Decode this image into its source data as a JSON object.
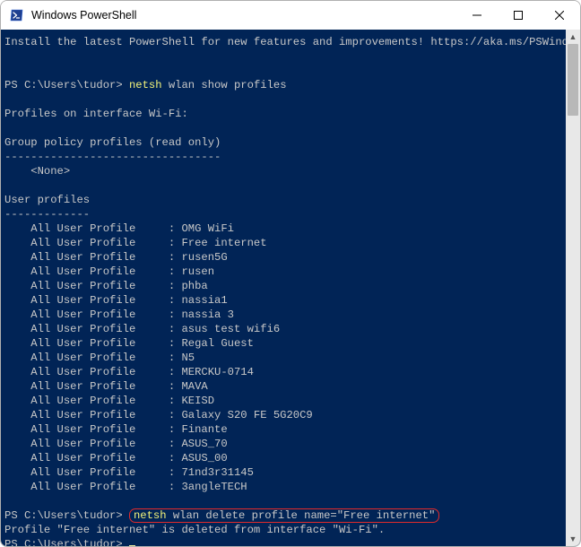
{
  "titlebar": {
    "title": "Windows PowerShell"
  },
  "banner": "Install the latest PowerShell for new features and improvements! https://aka.ms/PSWindows",
  "prompt": {
    "path": "PS C:\\Users\\tudor> "
  },
  "cmd1": "netsh",
  "cmd1_rest": " wlan show profiles",
  "section": {
    "interface": "Profiles on interface Wi-Fi:"
  },
  "gpp": {
    "header": "Group policy profiles (read only)",
    "rule": "---------------------------------",
    "none": "    <None>"
  },
  "up": {
    "header": "User profiles",
    "rule": "-------------"
  },
  "profile_label": "    All User Profile     : ",
  "profiles": [
    "OMG WiFi",
    "Free internet",
    "rusen5G",
    "rusen",
    "phba",
    "nassia1",
    "nassia 3",
    "asus test wifi6",
    "Regal Guest",
    "N5",
    "MERCKU-0714",
    "MAVA",
    "KEISD",
    "Galaxy S20 FE 5G20C9",
    "Finante",
    "ASUS_70",
    "ASUS_00",
    "71nd3r31145",
    "3angleTECH"
  ],
  "cmd2": "netsh",
  "cmd2_rest": " wlan delete profile name=\"Free internet\"",
  "result": "Profile \"Free internet\" is deleted from interface \"Wi-Fi\"."
}
